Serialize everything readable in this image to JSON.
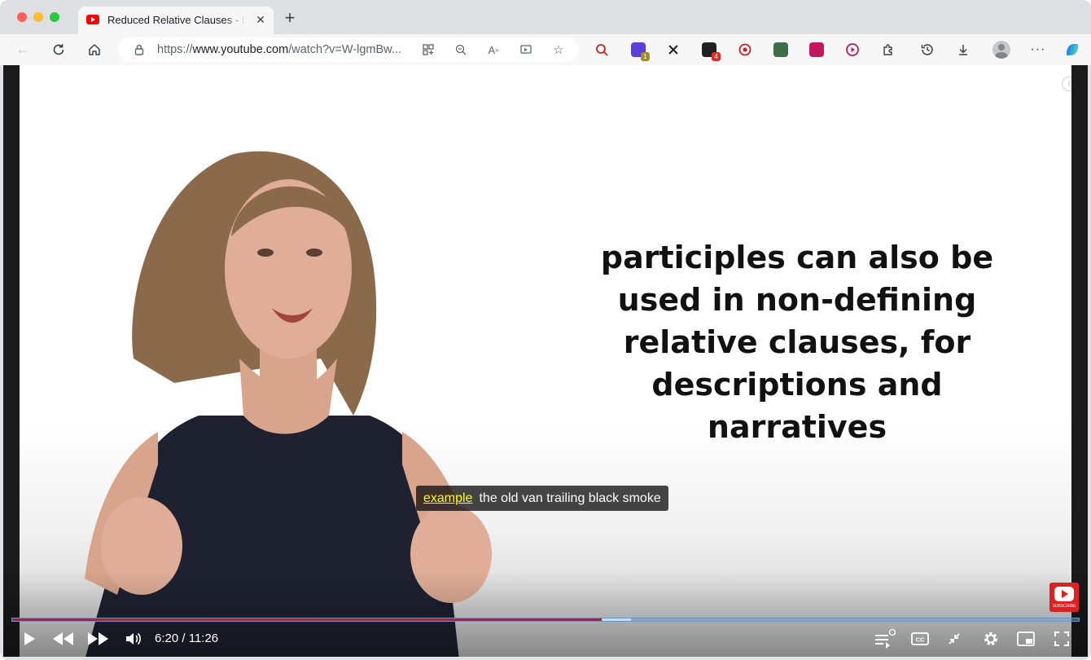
{
  "browser": {
    "tab": {
      "title": "Reduced Relative Clauses - De",
      "favicon": "youtube-favicon-icon"
    },
    "url": {
      "prefix": "https://",
      "host": "www.youtube.com",
      "path": "/watch?v=W-lgmBw..."
    },
    "extensions": [
      {
        "name": "extension-search-icon",
        "badge": ""
      },
      {
        "name": "extension-notes-icon",
        "badge": "1"
      },
      {
        "name": "extension-connect-icon",
        "badge": ""
      },
      {
        "name": "extension-tasks-icon",
        "badge": "4"
      },
      {
        "name": "extension-record-icon",
        "badge": ""
      },
      {
        "name": "extension-download-icon",
        "badge": ""
      },
      {
        "name": "extension-board-icon",
        "badge": ""
      },
      {
        "name": "extension-play-icon",
        "badge": ""
      }
    ],
    "colors": {
      "accent": "#1a73e8",
      "tab_bg": "#f7f7f8",
      "frame_bg": "#dedfe3"
    }
  },
  "video": {
    "slide_text": "participles can also be used in non-defining relative clauses, for descriptions and narratives",
    "caption": {
      "highlight": "example",
      "text": "the old van trailing black smoke"
    },
    "subscribe_label": "SUBSCRIBE",
    "info_label": "i",
    "progress": {
      "played_fraction": 0.553,
      "buffered_fraction": 0.58
    },
    "time": {
      "current": "6:20",
      "separator": " / ",
      "duration": "11:26"
    },
    "colors": {
      "played": "#ff0000",
      "caption_highlight": "#ffff00"
    }
  }
}
